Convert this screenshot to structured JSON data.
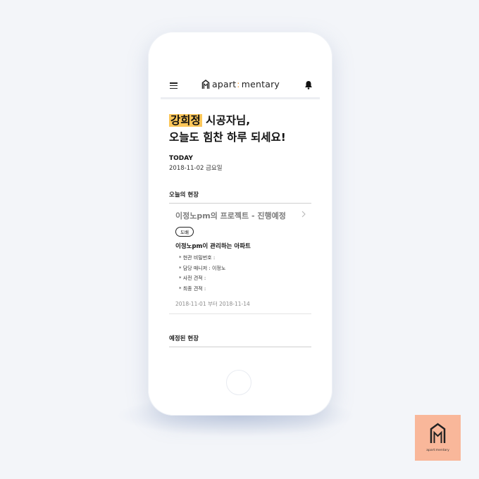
{
  "app": {
    "brand_prefix": "apart",
    "brand_sep": ":",
    "brand_suffix": "mentary",
    "accent_color": "#fcc75a",
    "tile_color": "#f9b79a"
  },
  "header": {
    "menu_icon": "hamburger-menu-icon",
    "bell_icon": "bell-icon"
  },
  "greeting": {
    "name": "강희정",
    "name_suffix": " 시공자님,",
    "line2": "오늘도 힘찬 하루 되세요!"
  },
  "today": {
    "label": "TODAY",
    "date": "2018-11-02 금요일"
  },
  "today_site": {
    "section_title": "오늘의 현장",
    "project_title": "이정노pm의 프로젝트 - 진행예정",
    "badge": "도배",
    "apartment": "이정노pm이 관리하는 아파트",
    "details": [
      "* 현관 비밀번호 :",
      "* 담당 매니저 : 이정노",
      "* 사전 견적 :",
      "* 최종 견적 :"
    ],
    "period": "2018-11-01 부터 2018-11-14"
  },
  "scheduled_site": {
    "section_title": "예정된 현장"
  },
  "brand_tile": {
    "text": "apart:mentary"
  }
}
